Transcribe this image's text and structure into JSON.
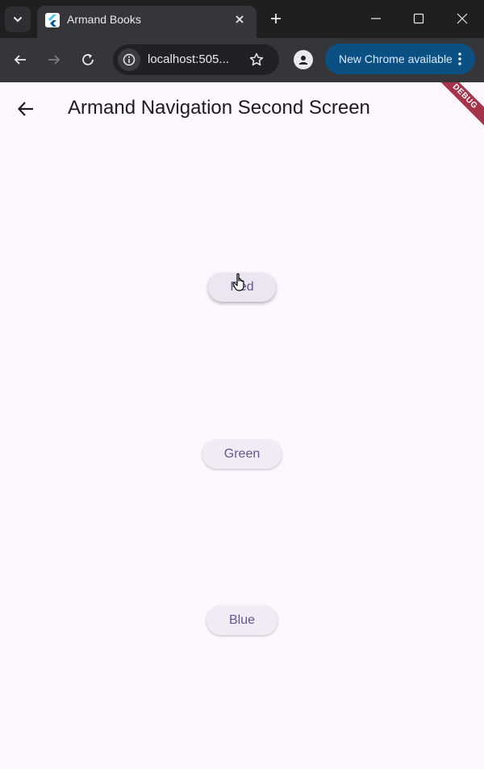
{
  "browser": {
    "tab_title": "Armand Books",
    "tab_favicon_icon": "flutter-icon",
    "url": "localhost:505...",
    "update_chip_label": "New Chrome available",
    "colors": {
      "titlebar": "#1f1f1f",
      "toolbar": "#35363a",
      "update_chip": "#0b5083"
    }
  },
  "app": {
    "title": "Armand Navigation Second Screen",
    "debug_banner": "DEBUG",
    "buttons": [
      {
        "label": "Red"
      },
      {
        "label": "Green"
      },
      {
        "label": "Blue"
      }
    ],
    "colors": {
      "background": "#fef7ff",
      "button_bg": "#f1ebf6",
      "button_text": "#65558f",
      "banner": "#a5334a"
    }
  }
}
